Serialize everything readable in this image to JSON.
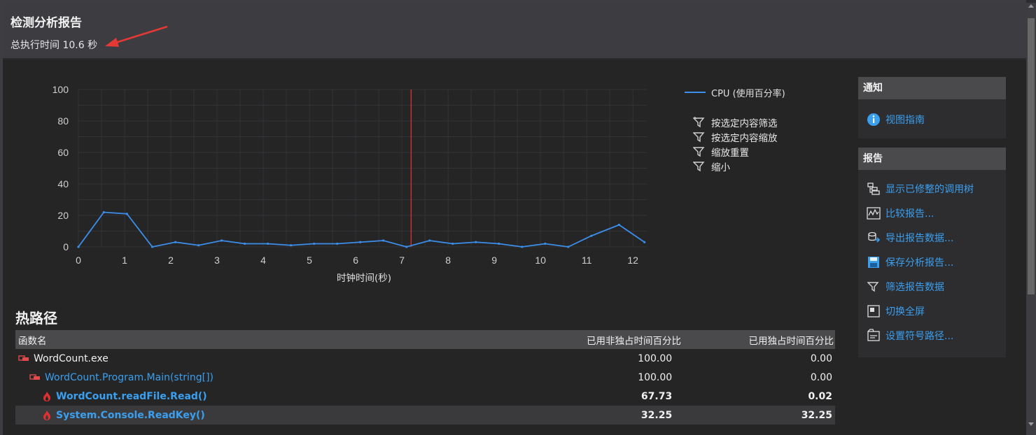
{
  "header": {
    "title": "检测分析报告",
    "exec_time": "总执行时间 10.6 秒"
  },
  "colors": {
    "accent_link": "#3b9fef",
    "cpu_line": "#3b8eea",
    "marker": "#e03030",
    "arrow": "#e53935"
  },
  "chart_data": {
    "type": "line",
    "xlabel": "时钟时间(秒)",
    "ylabel": "",
    "xlim": [
      0,
      12.3
    ],
    "ylim": [
      0,
      100
    ],
    "x_ticks": [
      "0",
      "1",
      "2",
      "3",
      "4",
      "5",
      "6",
      "7",
      "8",
      "9",
      "10",
      "11",
      "12"
    ],
    "y_ticks": [
      "0",
      "20",
      "40",
      "60",
      "80",
      "100"
    ],
    "grid": true,
    "legend_position": "right",
    "marker_x": 7.2,
    "series": [
      {
        "name": "CPU (使用百分率)",
        "x": [
          0,
          0.55,
          1.05,
          1.6,
          2.1,
          2.6,
          3.1,
          3.6,
          4.1,
          4.6,
          5.1,
          5.6,
          6.1,
          6.6,
          7.1,
          7.6,
          8.1,
          8.6,
          9.1,
          9.6,
          10.1,
          10.6,
          11.1,
          11.7,
          12.25
        ],
        "values": [
          0,
          22,
          21,
          0,
          3,
          1,
          4,
          2,
          2,
          1,
          2,
          2,
          3,
          4,
          0,
          4,
          2,
          3,
          2,
          0,
          2,
          0,
          7,
          14,
          3
        ]
      }
    ]
  },
  "chart_actions": [
    {
      "label": "按选定内容筛选",
      "icon": "filter-select-icon"
    },
    {
      "label": "按选定内容缩放",
      "icon": "filter-icon"
    },
    {
      "label": "缩放重置",
      "icon": "filter-icon"
    },
    {
      "label": "缩小",
      "icon": "filter-icon"
    }
  ],
  "hotpath": {
    "title": "热路径",
    "columns": [
      "函数名",
      "已用非独占时间百分比",
      "已用独占时间百分比"
    ],
    "rows": [
      {
        "name": "WordCount.exe",
        "inclusive": "100.00",
        "exclusive": "0.00",
        "icon": "module-icon"
      },
      {
        "name": "WordCount.Program.Main(string[])",
        "inclusive": "100.00",
        "exclusive": "0.00",
        "icon": "function-icon"
      },
      {
        "name": "WordCount.readFile.Read()",
        "inclusive": "67.73",
        "exclusive": "0.02",
        "icon": "flame-icon"
      },
      {
        "name": "System.Console.ReadKey()",
        "inclusive": "32.25",
        "exclusive": "32.25",
        "icon": "flame-icon"
      }
    ]
  },
  "notify_panel": {
    "title": "通知",
    "items": [
      {
        "label": "视图指南",
        "icon": "info-icon"
      }
    ]
  },
  "report_panel": {
    "title": "报告",
    "items": [
      {
        "label": "显示已修整的调用树",
        "icon": "call-tree-icon"
      },
      {
        "label": "比较报告...",
        "icon": "compare-icon"
      },
      {
        "label": "导出报告数据...",
        "icon": "export-icon"
      },
      {
        "label": "保存分析报告...",
        "icon": "save-icon"
      },
      {
        "label": "筛选报告数据",
        "icon": "filter-icon"
      },
      {
        "label": "切换全屏",
        "icon": "fullscreen-icon"
      },
      {
        "label": "设置符号路径...",
        "icon": "symbol-path-icon"
      }
    ]
  }
}
